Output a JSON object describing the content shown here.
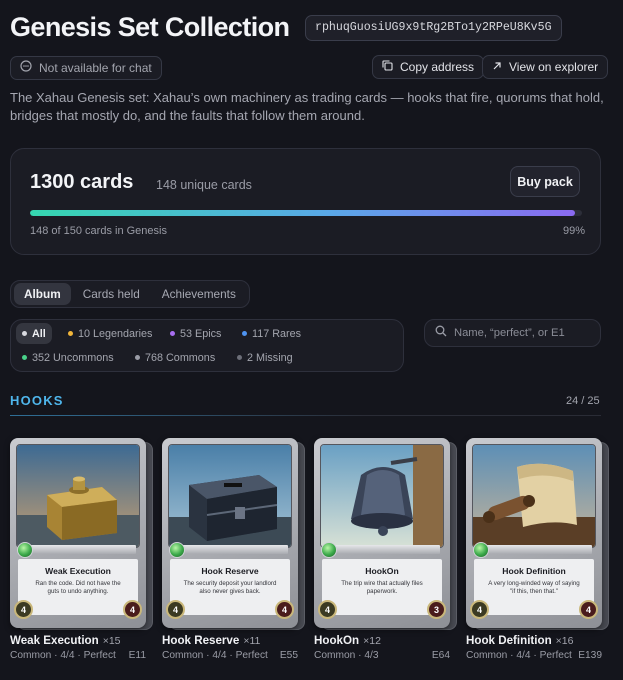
{
  "header": {
    "title": "Genesis Set Collection",
    "address": "rphuqGuosiUG9x9tRg2BTo1y2RPeU8Kv5G",
    "chat_status": "Not available for chat",
    "copy_label": "Copy address",
    "explorer_label": "View on explorer",
    "description": "The Xahau Genesis set: Xahau’s own machinery as trading cards — hooks that fire, quorums that hold, bridges that mostly do, and the faults that follow them around."
  },
  "stats": {
    "total_cards": "1300 cards",
    "unique_cards": "148 unique cards",
    "buy_label": "Buy pack",
    "progress_text": "148 of 150 cards in Genesis",
    "progress_percent": "99%",
    "progress_fraction": 0.987
  },
  "tabs": [
    {
      "label": "Album",
      "active": true
    },
    {
      "label": "Cards held",
      "active": false
    },
    {
      "label": "Achievements",
      "active": false
    }
  ],
  "filters": [
    {
      "label": "All",
      "color": "#d9dae0",
      "active": true
    },
    {
      "label": "10 Legendaries",
      "color": "#f2b63a",
      "active": false
    },
    {
      "label": "53 Epics",
      "color": "#a86ef0",
      "active": false
    },
    {
      "label": "117 Rares",
      "color": "#4e93f0",
      "active": false
    },
    {
      "label": "352 Uncommons",
      "color": "#49d28a",
      "active": false
    },
    {
      "label": "768 Commons",
      "color": "#9a9ca6",
      "active": false
    },
    {
      "label": "2 Missing",
      "color": "#6c6e78",
      "active": false
    }
  ],
  "search": {
    "placeholder": "Name, “perfect”, or E1"
  },
  "section": {
    "title": "HOOKS",
    "count": "24 / 25"
  },
  "cards": [
    {
      "name": "Weak Execution",
      "count": "×15",
      "flavor": "Ran the code. Did not have the guts to undo anything.",
      "left_stat": "4",
      "right_stat": "4",
      "meta": "Common · 4/4 · Perfect",
      "code": "E11",
      "art": "box"
    },
    {
      "name": "Hook Reserve",
      "count": "×11",
      "flavor": "The security deposit your landlord also never gives back.",
      "left_stat": "4",
      "right_stat": "4",
      "meta": "Common · 4/4 · Perfect",
      "code": "E55",
      "art": "chest"
    },
    {
      "name": "HookOn",
      "count": "×12",
      "flavor": "The trip wire that actually files paperwork.",
      "left_stat": "4",
      "right_stat": "3",
      "meta": "Common · 4/3",
      "code": "E64",
      "art": "bell"
    },
    {
      "name": "Hook Definition",
      "count": "×16",
      "flavor": "A very long-winded way of saying \"if this, then that.\"",
      "left_stat": "4",
      "right_stat": "4",
      "meta": "Common · 4/4 · Perfect",
      "code": "E139",
      "art": "scroll"
    }
  ]
}
